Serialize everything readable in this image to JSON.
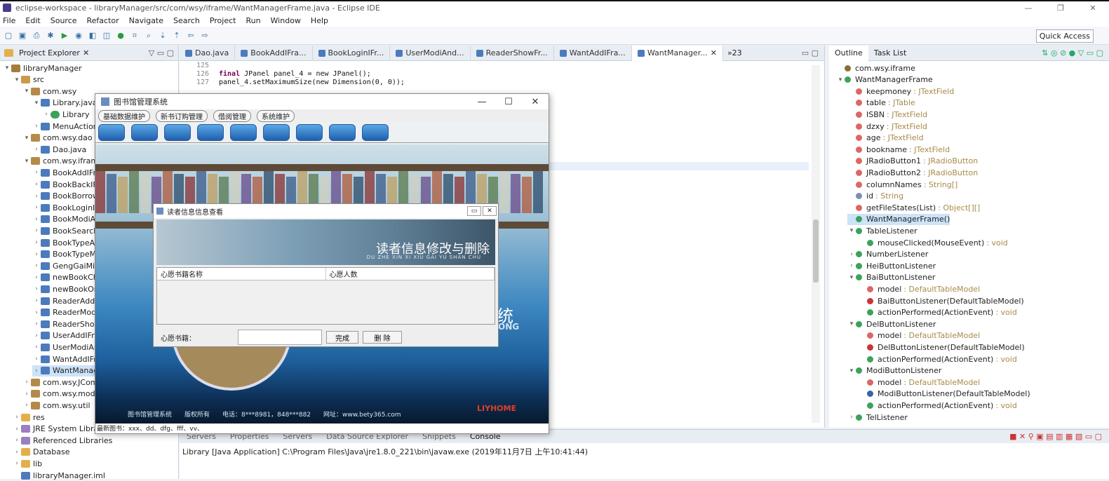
{
  "window": {
    "title": "eclipse-workspace - libraryManager/src/com/wsy/iframe/WantManagerFrame.java - Eclipse IDE"
  },
  "menu": [
    "File",
    "Edit",
    "Source",
    "Refactor",
    "Navigate",
    "Search",
    "Project",
    "Run",
    "Window",
    "Help"
  ],
  "toolbar": {
    "quick_access": "Quick Access"
  },
  "project_explorer": {
    "title": "Project Explorer",
    "items": [
      {
        "label": "libraryManager",
        "indent": 0,
        "icon": "proj",
        "twisty": "v"
      },
      {
        "label": "src",
        "indent": 1,
        "icon": "src",
        "twisty": "v"
      },
      {
        "label": "com.wsy",
        "indent": 2,
        "icon": "pkg",
        "twisty": "v"
      },
      {
        "label": "Library.java",
        "indent": 3,
        "icon": "java",
        "twisty": "v"
      },
      {
        "label": "Library",
        "indent": 4,
        "icon": "class",
        "twisty": ">"
      },
      {
        "label": "MenuActions",
        "indent": 3,
        "icon": "java",
        "twisty": ">"
      },
      {
        "label": "com.wsy.dao",
        "indent": 2,
        "icon": "pkg",
        "twisty": "v"
      },
      {
        "label": "Dao.java",
        "indent": 3,
        "icon": "java",
        "twisty": ">"
      },
      {
        "label": "com.wsy.iframe",
        "indent": 2,
        "icon": "pkg",
        "twisty": "v"
      },
      {
        "label": "BookAddIFrame",
        "indent": 3,
        "icon": "java",
        "twisty": ">"
      },
      {
        "label": "BookBackIFrame",
        "indent": 3,
        "icon": "java",
        "twisty": ">"
      },
      {
        "label": "BookBorrowIFrame",
        "indent": 3,
        "icon": "java",
        "twisty": ">"
      },
      {
        "label": "BookLoginIFrame",
        "indent": 3,
        "icon": "java",
        "twisty": ">"
      },
      {
        "label": "BookModiAndDelIFrame",
        "indent": 3,
        "icon": "java",
        "twisty": ">"
      },
      {
        "label": "BookSearchIFrame",
        "indent": 3,
        "icon": "java",
        "twisty": ">"
      },
      {
        "label": "BookTypeAddIFrame",
        "indent": 3,
        "icon": "java",
        "twisty": ">"
      },
      {
        "label": "BookTypeModiAndDelIFrame",
        "indent": 3,
        "icon": "java",
        "twisty": ">"
      },
      {
        "label": "GengGaiMiMa",
        "indent": 3,
        "icon": "java",
        "twisty": ">"
      },
      {
        "label": "newBookCheckIFrame",
        "indent": 3,
        "icon": "java",
        "twisty": ">"
      },
      {
        "label": "newBookOrderIFrame",
        "indent": 3,
        "icon": "java",
        "twisty": ">"
      },
      {
        "label": "ReaderAddIFrame",
        "indent": 3,
        "icon": "java",
        "twisty": ">"
      },
      {
        "label": "ReaderModiAndDelIFrame",
        "indent": 3,
        "icon": "java",
        "twisty": ">"
      },
      {
        "label": "ReaderShowIFrame",
        "indent": 3,
        "icon": "java",
        "twisty": ">"
      },
      {
        "label": "UserAddIFrame",
        "indent": 3,
        "icon": "java",
        "twisty": ">"
      },
      {
        "label": "UserModiAndDelIFrame",
        "indent": 3,
        "icon": "java",
        "twisty": ">"
      },
      {
        "label": "WantAddIFrame",
        "indent": 3,
        "icon": "java",
        "twisty": ">"
      },
      {
        "label": "WantManagerFrame",
        "indent": 3,
        "icon": "java",
        "twisty": ">",
        "selected": true
      },
      {
        "label": "com.wsy.JComPz",
        "indent": 2,
        "icon": "pkg",
        "twisty": ">"
      },
      {
        "label": "com.wsy.model",
        "indent": 2,
        "icon": "pkg",
        "twisty": ">"
      },
      {
        "label": "com.wsy.util",
        "indent": 2,
        "icon": "pkg",
        "twisty": ">"
      },
      {
        "label": "res",
        "indent": 1,
        "icon": "folder",
        "twisty": ">"
      },
      {
        "label": "JRE System Library",
        "indent": 1,
        "icon": "lib",
        "twisty": ">"
      },
      {
        "label": "Referenced Libraries",
        "indent": 1,
        "icon": "lib",
        "twisty": ">"
      },
      {
        "label": "Database",
        "indent": 1,
        "icon": "folder",
        "twisty": ">"
      },
      {
        "label": "lib",
        "indent": 1,
        "icon": "folder",
        "twisty": ">"
      },
      {
        "label": "libraryManager.iml",
        "indent": 1,
        "icon": "java",
        "twisty": ""
      }
    ]
  },
  "editor": {
    "tabs": [
      "Dao.java",
      "BookAddIFra...",
      "BookLoginIFr...",
      "UserModiAnd...",
      "ReaderShowFr...",
      "WantAddIFra...",
      "WantManager..."
    ],
    "active_tab": 6,
    "overflow_count": "23",
    "lines": [
      {
        "n": "125",
        "code": ""
      },
      {
        "n": "126",
        "kw": "final",
        "code": " JPanel panel_4 = new JPanel();"
      },
      {
        "n": "127",
        "kw": "",
        "code": "panel_4.setMaximumSize(new Dimension(0, 0));"
      }
    ]
  },
  "outline": {
    "tabs": [
      "Outline",
      "Task List"
    ],
    "items": [
      {
        "label": "com.wsy.iframe",
        "type": "",
        "indent": 0,
        "color": "#8a6d3b"
      },
      {
        "label": "WantManagerFrame",
        "type": "",
        "indent": 0,
        "color": "#3aa35a",
        "twisty": "v"
      },
      {
        "label": "keepmoney",
        "type": "JTextField",
        "indent": 1,
        "color": "#d66"
      },
      {
        "label": "table",
        "type": "JTable",
        "indent": 1,
        "color": "#d66"
      },
      {
        "label": "ISBN",
        "type": "JTextField",
        "indent": 1,
        "color": "#d66"
      },
      {
        "label": "dzxy",
        "type": "JTextField",
        "indent": 1,
        "color": "#d66"
      },
      {
        "label": "age",
        "type": "JTextField",
        "indent": 1,
        "color": "#d66"
      },
      {
        "label": "bookname",
        "type": "JTextField",
        "indent": 1,
        "color": "#d66"
      },
      {
        "label": "JRadioButton1",
        "type": "JRadioButton",
        "indent": 1,
        "color": "#d66"
      },
      {
        "label": "JRadioButton2",
        "type": "JRadioButton",
        "indent": 1,
        "color": "#d66"
      },
      {
        "label": "columnNames",
        "type": "String[]",
        "indent": 1,
        "color": "#d66"
      },
      {
        "label": "id",
        "type": "String",
        "indent": 1,
        "color": "#7b8fb8"
      },
      {
        "label": "getFileStates(List)",
        "type": "Object[][]",
        "indent": 1,
        "color": "#d66"
      },
      {
        "label": "WantManagerFrame()",
        "type": "",
        "indent": 1,
        "color": "#3aa35a",
        "selected": true
      },
      {
        "label": "TableListener",
        "type": "",
        "indent": 1,
        "color": "#3aa35a",
        "twisty": "v"
      },
      {
        "label": "mouseClicked(MouseEvent)",
        "type": "void",
        "indent": 2,
        "color": "#3aa35a"
      },
      {
        "label": "NumberListener",
        "type": "",
        "indent": 1,
        "color": "#3aa35a",
        "twisty": ">"
      },
      {
        "label": "HeiButtonListener",
        "type": "",
        "indent": 1,
        "color": "#3aa35a",
        "twisty": ">"
      },
      {
        "label": "BaiButtonListener",
        "type": "",
        "indent": 1,
        "color": "#3aa35a",
        "twisty": "v"
      },
      {
        "label": "model",
        "type": "DefaultTableModel",
        "indent": 2,
        "color": "#d66"
      },
      {
        "label": "BaiButtonListener(DefaultTableModel)",
        "type": "",
        "indent": 2,
        "color": "#c33"
      },
      {
        "label": "actionPerformed(ActionEvent)",
        "type": "void",
        "indent": 2,
        "color": "#3aa35a"
      },
      {
        "label": "DelButtonListener",
        "type": "",
        "indent": 1,
        "color": "#3aa35a",
        "twisty": "v"
      },
      {
        "label": "model",
        "type": "DefaultTableModel",
        "indent": 2,
        "color": "#d66"
      },
      {
        "label": "DelButtonListener(DefaultTableModel)",
        "type": "",
        "indent": 2,
        "color": "#c33"
      },
      {
        "label": "actionPerformed(ActionEvent)",
        "type": "void",
        "indent": 2,
        "color": "#3aa35a"
      },
      {
        "label": "ModiButtonListener",
        "type": "",
        "indent": 1,
        "color": "#3aa35a",
        "twisty": "v"
      },
      {
        "label": "model",
        "type": "DefaultTableModel",
        "indent": 2,
        "color": "#d66"
      },
      {
        "label": "ModiButtonListener(DefaultTableModel)",
        "type": "",
        "indent": 2,
        "color": "#36a"
      },
      {
        "label": "actionPerformed(ActionEvent)",
        "type": "void",
        "indent": 2,
        "color": "#3aa35a"
      },
      {
        "label": "TelListener",
        "type": "",
        "indent": 1,
        "color": "#3aa35a",
        "twisty": ">"
      }
    ]
  },
  "bottom_panel": {
    "tabs": [
      "Servers",
      "Properties",
      "Servers",
      "Data Source Explorer",
      "Snippets",
      "Console"
    ],
    "console_text": "Library [Java Application] C:\\Program Files\\Java\\jre1.8.0_221\\bin\\javaw.exe (2019年11月7日 上午10:41:44)"
  },
  "app": {
    "title": "图书馆管理系统",
    "menus": [
      "基础数据维护",
      "新书订购管理",
      "借阅管理",
      "系统维护"
    ],
    "tool_count": 9,
    "banner_text": "统",
    "banner_sub": "ONG",
    "footer": [
      "图书馆管理系统",
      "版权所有",
      "电话：8***8981，848***882",
      "网址：www.bety365.com"
    ],
    "logo": "LIYHOME",
    "status": "最新图书：xxx、dd、dfg、fff、vv、"
  },
  "dialog": {
    "title": "读者信息信息查看",
    "banner_title": "读者信息修改与删除",
    "banner_pinyin": "DU ZHE XIN XI XIU GAI YU SHAN CHU",
    "columns": [
      "心愿书籍名称",
      "心愿人数"
    ],
    "form_label": "心愿书籍：",
    "input_value": "",
    "ok_button": "完成",
    "delete_button": "删 除"
  }
}
